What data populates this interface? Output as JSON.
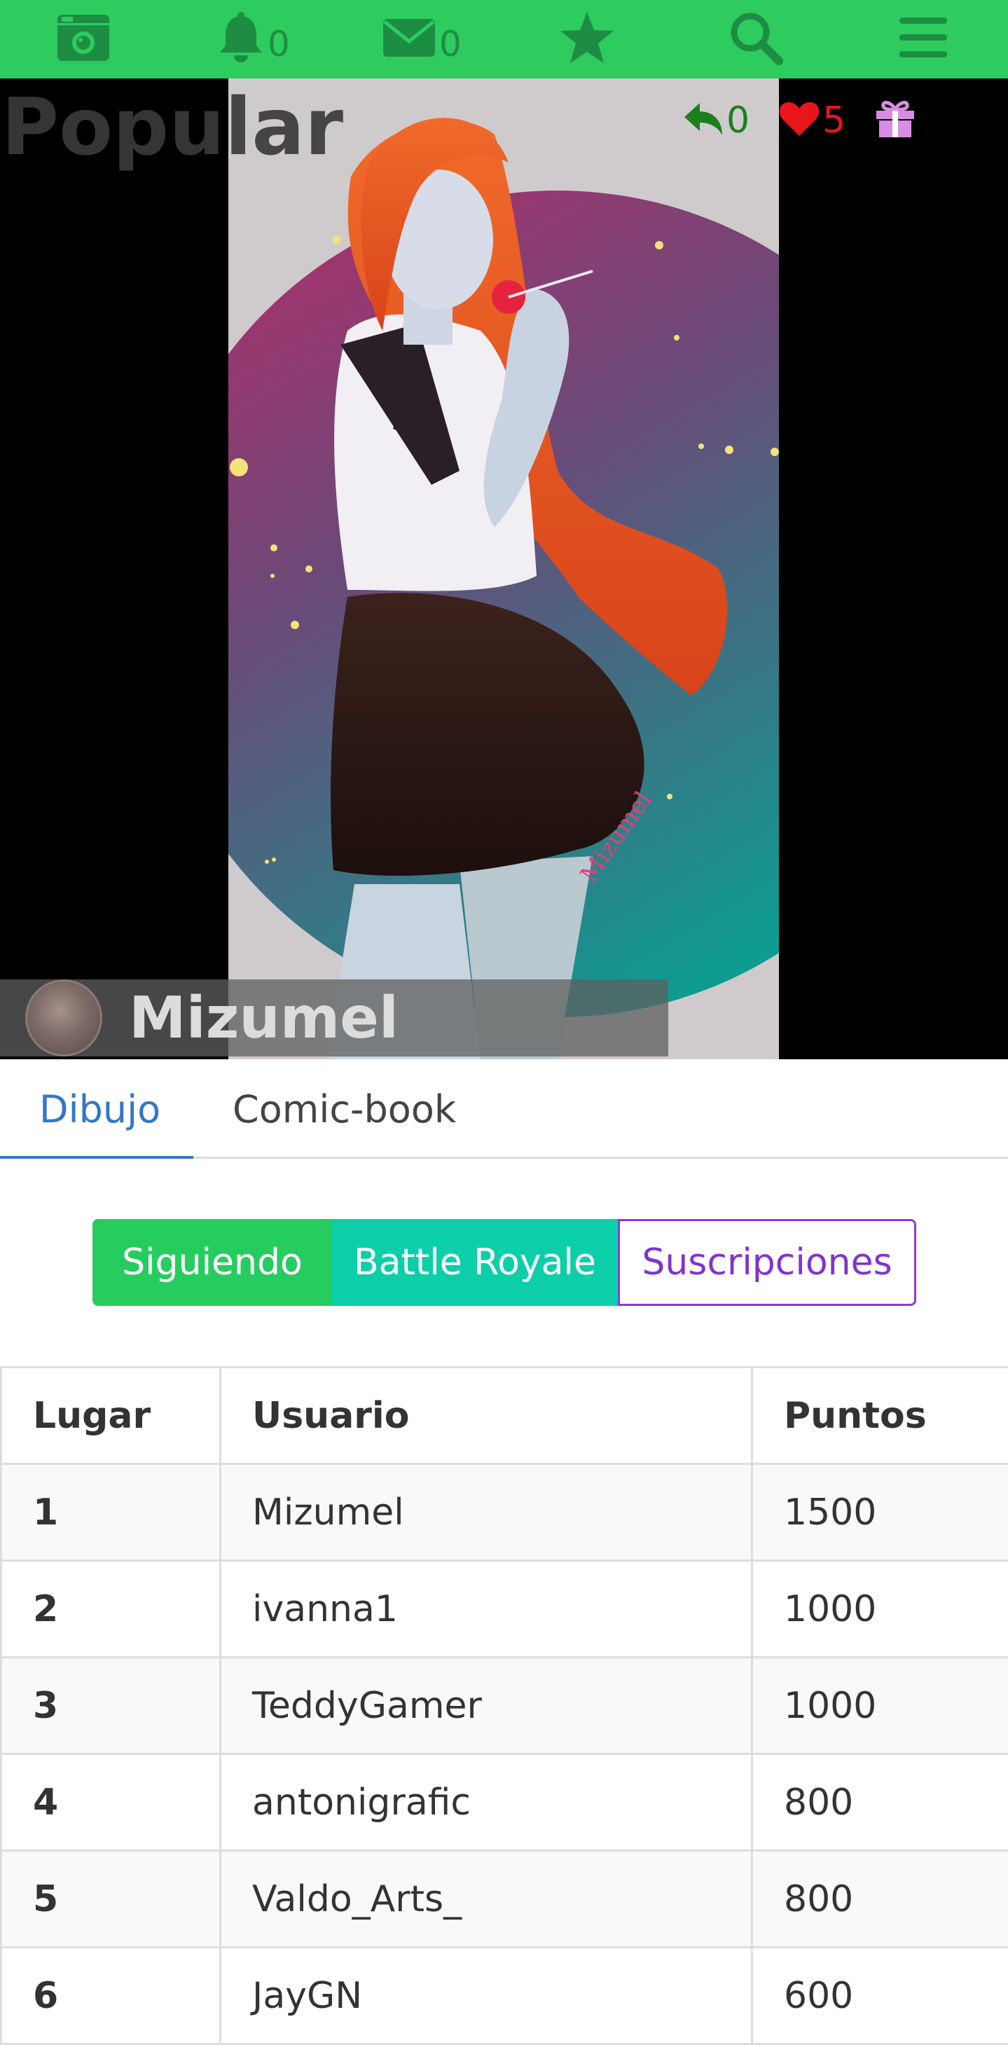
{
  "nav": {
    "items": [
      {
        "icon": "camera-icon"
      },
      {
        "icon": "bell-icon",
        "count": "0"
      },
      {
        "icon": "envelope-icon",
        "count": "0"
      },
      {
        "icon": "star-icon"
      },
      {
        "icon": "search-icon"
      },
      {
        "icon": "menu-icon"
      }
    ]
  },
  "hero": {
    "title": "Popular",
    "replies": "0",
    "likes": "5",
    "author": "Mizumel"
  },
  "tabs": [
    {
      "label": "Dibujo",
      "active": true
    },
    {
      "label": "Comic-book",
      "active": false
    }
  ],
  "filters": {
    "following": "Siguiendo",
    "battle": "Battle Royale",
    "subscriptions": "Suscripciones"
  },
  "table": {
    "headers": [
      "Lugar",
      "Usuario",
      "Puntos"
    ],
    "rows": [
      {
        "place": "1",
        "user": "Mizumel",
        "points": "1500"
      },
      {
        "place": "2",
        "user": "ivanna1",
        "points": "1000"
      },
      {
        "place": "3",
        "user": "TeddyGamer",
        "points": "1000"
      },
      {
        "place": "4",
        "user": "antonigrafic",
        "points": "800"
      },
      {
        "place": "5",
        "user": "Valdo_Arts_",
        "points": "800"
      },
      {
        "place": "6",
        "user": "JayGN",
        "points": "600"
      }
    ]
  },
  "colors": {
    "nav_bg": "#2ecc5e",
    "nav_icon": "#1e8d44",
    "reply": "#1b7f1b",
    "like": "#e8151b",
    "gift": "#d78ee0",
    "tab_active": "#3476c8",
    "following_btn": "#27cc5f",
    "battle_btn": "#0ccfa9",
    "subs_btn": "#8233cf"
  }
}
